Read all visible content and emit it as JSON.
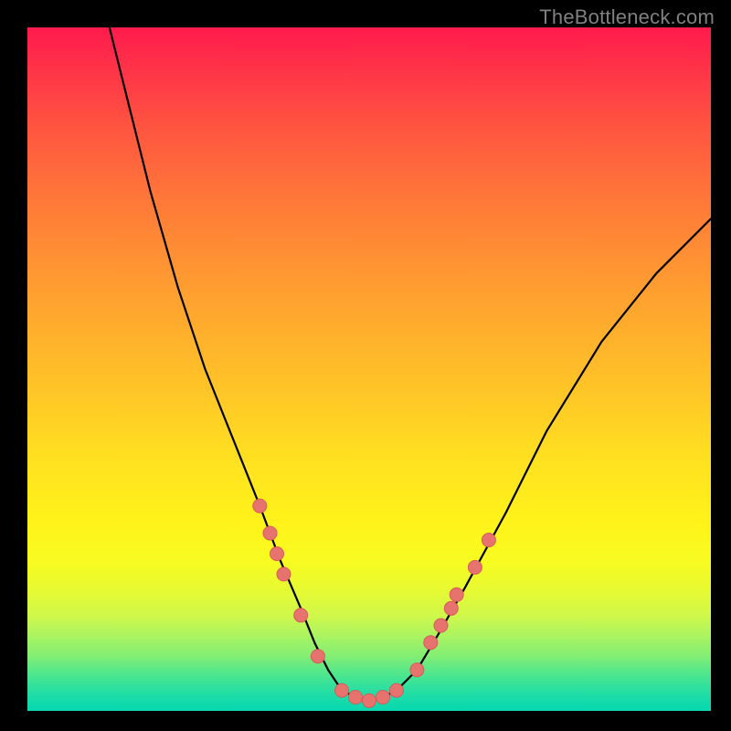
{
  "watermark": "TheBottleneck.com",
  "colors": {
    "page_bg": "#000000",
    "marker_fill": "#e7736f",
    "marker_stroke": "#d85a5a",
    "curve_stroke": "#000000",
    "gradient_top": "#ff1a4d",
    "gradient_bottom": "#07d7b0",
    "watermark": "#808080"
  },
  "chart_data": {
    "type": "line",
    "title": "",
    "xlabel": "",
    "ylabel": "",
    "xlim": [
      0,
      100
    ],
    "ylim": [
      0,
      100
    ],
    "note": "No axes, ticks, or legend are present in the image; values are estimated from gridless pixel positions. y is plotted with 0 at bottom, 100 at top.",
    "curve": {
      "x": [
        12,
        15,
        18,
        22,
        26,
        30,
        34,
        37,
        40,
        42,
        44,
        46,
        48,
        50,
        52,
        54,
        57,
        60,
        64,
        70,
        76,
        84,
        92,
        100
      ],
      "y": [
        100,
        88,
        76,
        62,
        50,
        40,
        30,
        22,
        15,
        10,
        6,
        3,
        2,
        1.5,
        2,
        3,
        6,
        11,
        18,
        29,
        41,
        54,
        64,
        72
      ]
    },
    "series": [
      {
        "name": "markers-left",
        "x": [
          34,
          35.5,
          36.5,
          37.5,
          40,
          42.5
        ],
        "y": [
          30,
          26,
          23,
          20,
          14,
          8
        ]
      },
      {
        "name": "markers-bottom",
        "x": [
          46,
          48,
          50,
          52,
          54
        ],
        "y": [
          3,
          2,
          1.5,
          2,
          3
        ]
      },
      {
        "name": "markers-right",
        "x": [
          57,
          59,
          60.5,
          62,
          62.8,
          65.5
        ],
        "y": [
          6,
          10,
          12.5,
          15,
          17,
          21
        ]
      },
      {
        "name": "markers-right-upper",
        "x": [
          67.5
        ],
        "y": [
          25
        ]
      }
    ]
  }
}
